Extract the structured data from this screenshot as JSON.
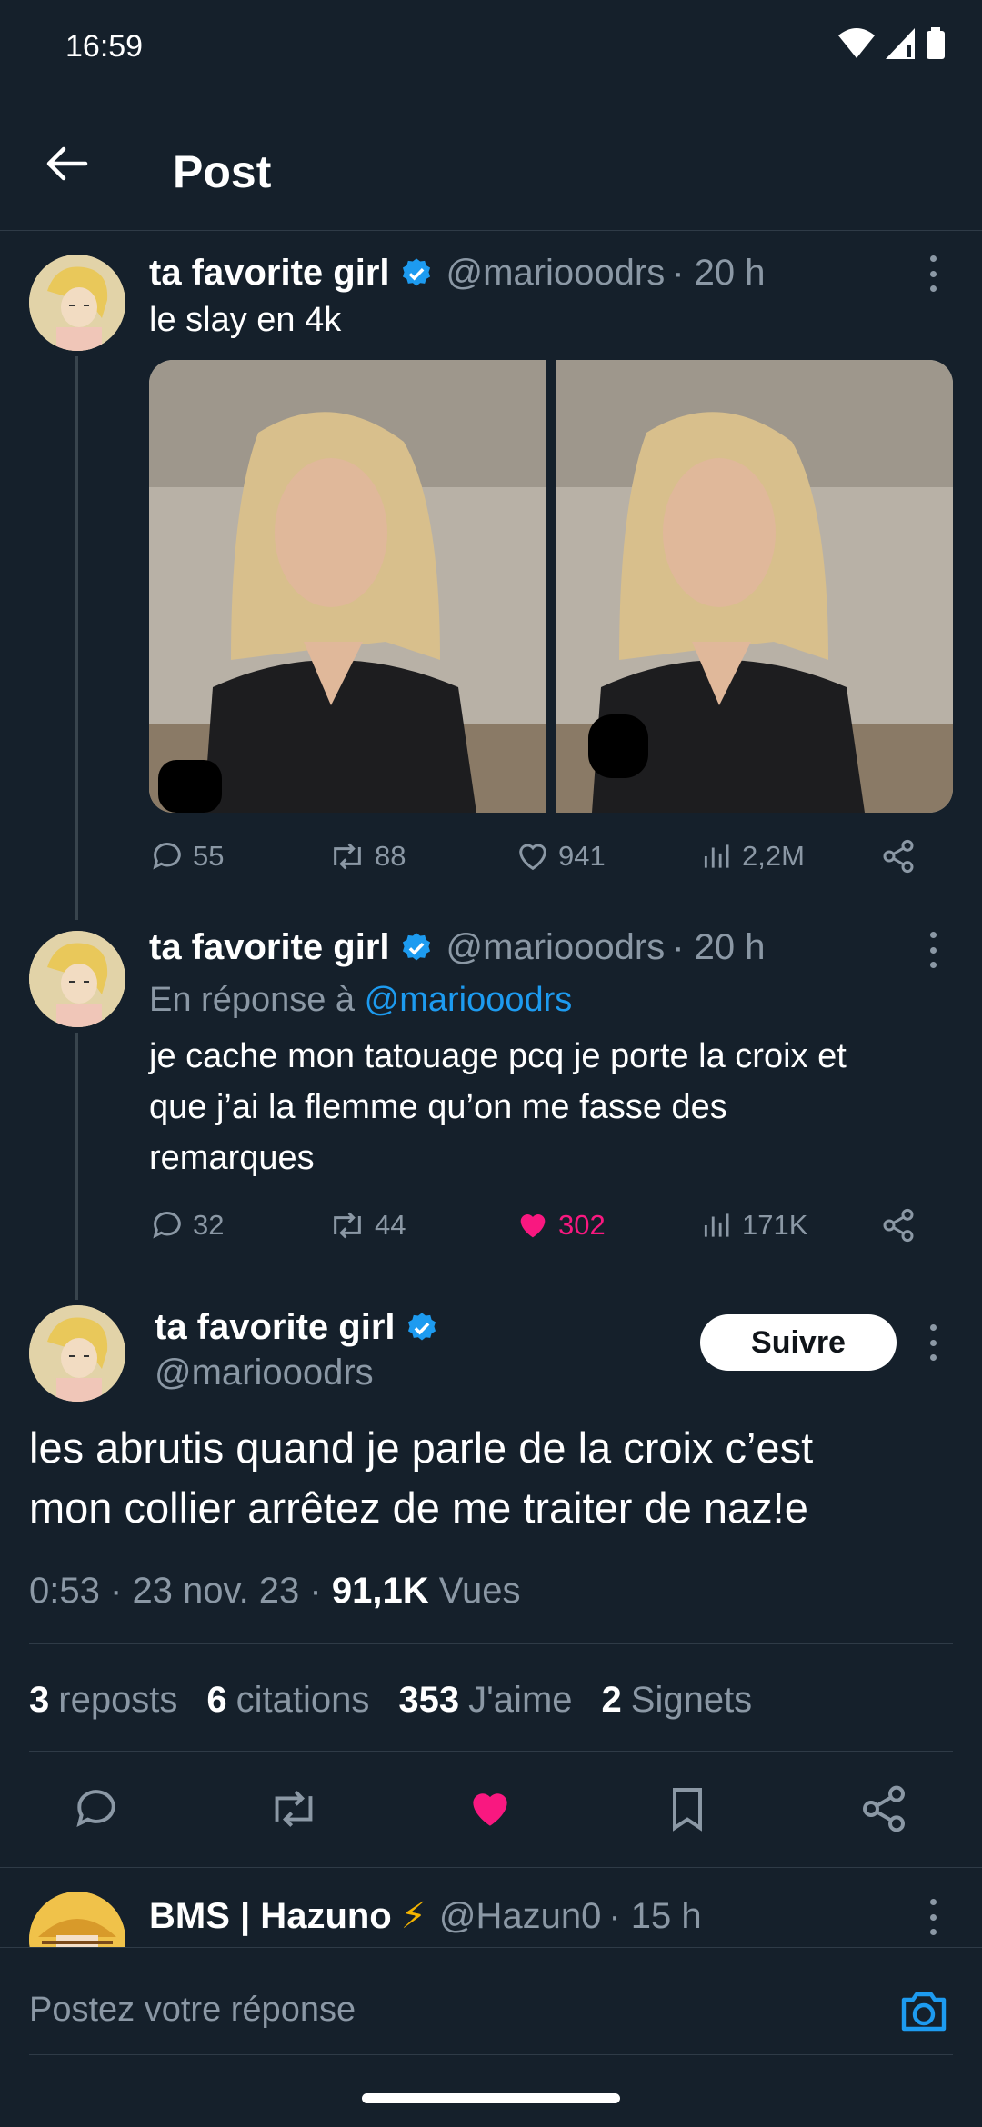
{
  "status_bar": {
    "time": "16:59"
  },
  "header": {
    "title": "Post"
  },
  "tweet1": {
    "author": "ta favorite girl",
    "handle": "@mariooodrs",
    "time": "· 20 h",
    "text": "le slay en 4k",
    "replies": "55",
    "reposts": "88",
    "likes": "941",
    "views": "2,2M"
  },
  "tweet2": {
    "author": "ta favorite girl",
    "handle": "@mariooodrs",
    "time": "· 20 h",
    "reply_prefix": "En réponse à",
    "reply_to": "@mariooodrs",
    "text_line1": "je cache mon tatouage pcq je porte la croix et",
    "text_line2": "que j’ai la flemme qu’on me fasse des",
    "text_line3": "remarques",
    "replies": "32",
    "reposts": "44",
    "likes": "302",
    "views": "171K",
    "liked_color": "#f91880"
  },
  "main_tweet": {
    "author": "ta favorite girl",
    "handle": "@mariooodrs",
    "follow_label": "Suivre",
    "text_line1": "les abrutis quand je parle de la croix c’est",
    "text_line2": "mon collier arrêtez de me traiter de naz!e",
    "time": "0:53",
    "date": "23 nov. 23",
    "views_count": "91,1K",
    "views_label": "Vues",
    "sep1": "·",
    "sep2": "·",
    "reposts_count": "3",
    "reposts_label": "reposts",
    "quotes_count": "6",
    "quotes_label": "citations",
    "likes_count": "353",
    "likes_label": "J'aime",
    "bookmarks_count": "2",
    "bookmarks_label": "Signets"
  },
  "next_reply": {
    "author": "BMS | Hazuno",
    "emoji": "⚡",
    "handle": "@Hazun0",
    "time": "· 15 h"
  },
  "reply_bar": {
    "placeholder": "Postez votre réponse"
  },
  "colors": {
    "background": "#15202b",
    "accent": "#1d9bf0",
    "like": "#f91880",
    "muted": "#8b98a5"
  }
}
